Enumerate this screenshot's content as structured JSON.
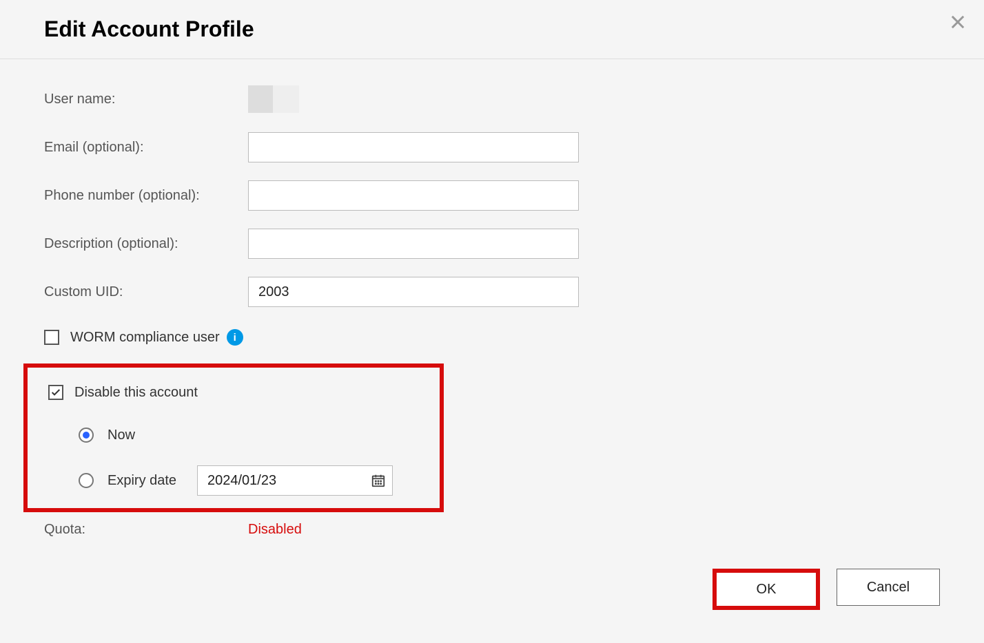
{
  "dialog": {
    "title": "Edit Account Profile"
  },
  "form": {
    "user_name_label": "User name:",
    "email_label": "Email (optional):",
    "email_value": "",
    "phone_label": "Phone number (optional):",
    "phone_value": "",
    "description_label": "Description (optional):",
    "description_value": "",
    "custom_uid_label": "Custom UID:",
    "custom_uid_value": "2003",
    "worm_label": "WORM compliance user",
    "worm_checked": false,
    "disable_label": "Disable this account",
    "disable_checked": true,
    "radio_now_label": "Now",
    "radio_now_selected": true,
    "radio_expiry_label": "Expiry date",
    "radio_expiry_selected": false,
    "expiry_date_value": "2024/01/23",
    "quota_label": "Quota:",
    "quota_value": "Disabled"
  },
  "footer": {
    "ok_label": "OK",
    "cancel_label": "Cancel"
  }
}
